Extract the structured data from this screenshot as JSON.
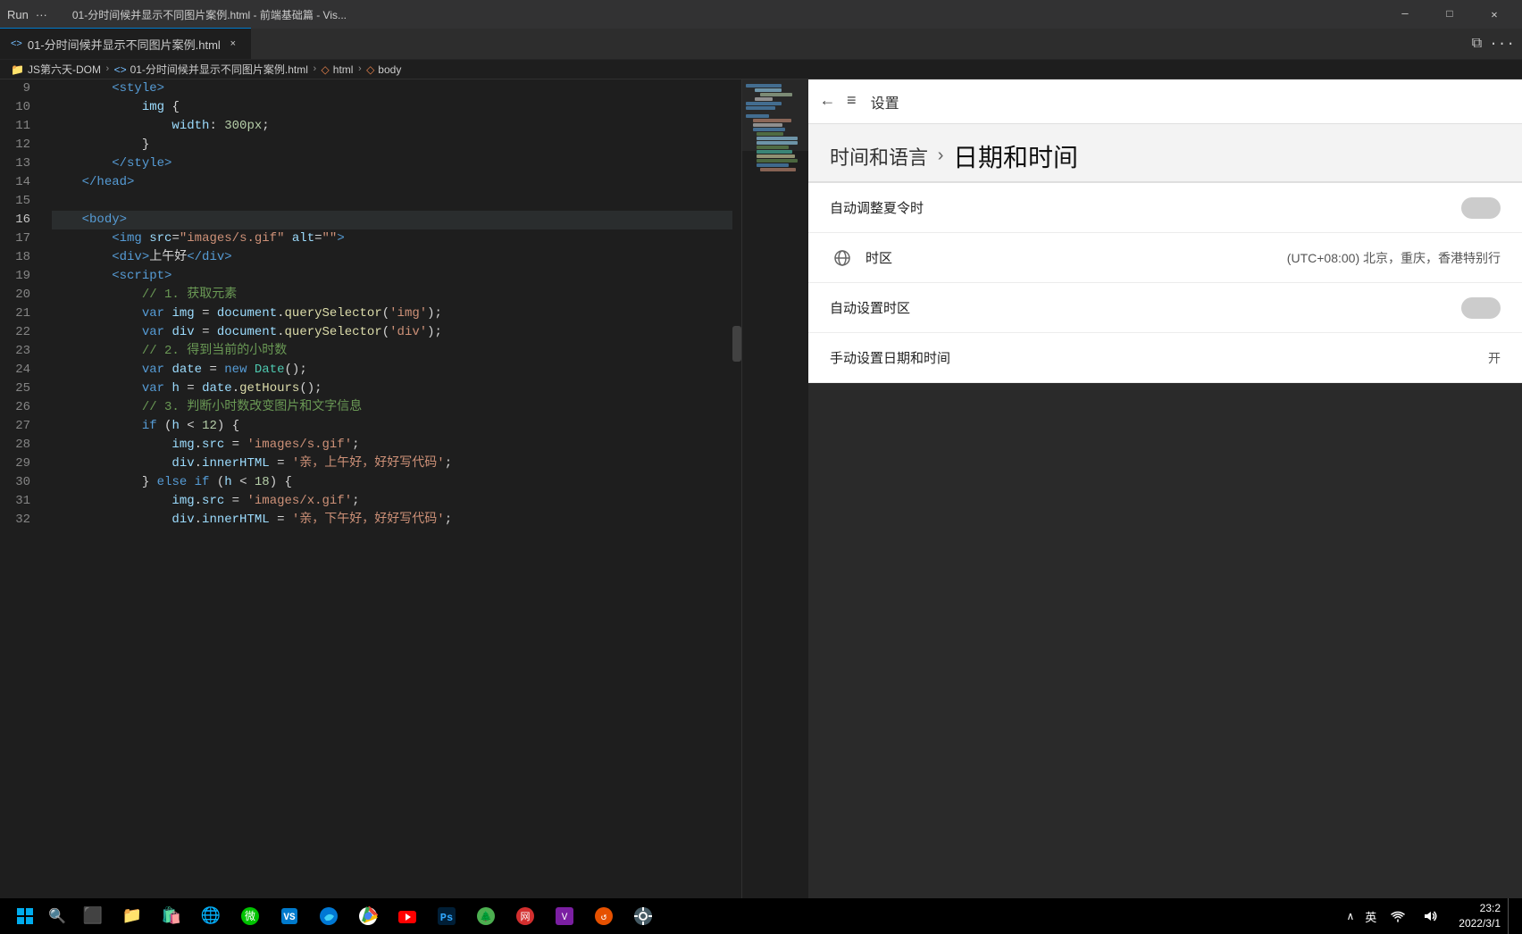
{
  "titlebar": {
    "menu_items": [
      "Run",
      "···"
    ],
    "title": "01-分时间候并显示不同图片案例.html - 前端基础篇 - Vis...",
    "controls": [
      "⬜",
      "❐",
      "✕"
    ]
  },
  "tab": {
    "icon": "<>",
    "label": "01-分时间候并显示不同图片案例.html",
    "close": "×"
  },
  "breadcrumb": {
    "items": [
      "JS第六天-DOM",
      "01-分时间候并显示不同图片案例.html",
      "html",
      "body"
    ]
  },
  "code": {
    "lines": [
      {
        "num": 9,
        "content": "        <style>"
      },
      {
        "num": 10,
        "content": "            img {"
      },
      {
        "num": 11,
        "content": "                width: 300px;"
      },
      {
        "num": 12,
        "content": "            }"
      },
      {
        "num": 13,
        "content": "        </style>"
      },
      {
        "num": 14,
        "content": "    </head>"
      },
      {
        "num": 15,
        "content": ""
      },
      {
        "num": 16,
        "content": "    <body>"
      },
      {
        "num": 17,
        "content": "        <img src=\"images/s.gif\" alt=\"\">"
      },
      {
        "num": 18,
        "content": "        <div>上午好</div>"
      },
      {
        "num": 19,
        "content": "        <script>"
      },
      {
        "num": 20,
        "content": "            // 1. 获取元素"
      },
      {
        "num": 21,
        "content": "            var img = document.querySelector('img');"
      },
      {
        "num": 22,
        "content": "            var div = document.querySelector('div');"
      },
      {
        "num": 23,
        "content": "            // 2. 得到当前的小时数"
      },
      {
        "num": 24,
        "content": "            var date = new Date();"
      },
      {
        "num": 25,
        "content": "            var h = date.getHours();"
      },
      {
        "num": 26,
        "content": "            // 3. 判断小时数改变图片和文字信息"
      },
      {
        "num": 27,
        "content": "            if (h < 12) {"
      },
      {
        "num": 28,
        "content": "                img.src = 'images/s.gif';"
      },
      {
        "num": 29,
        "content": "                div.innerHTML = '亲，上午好，好好写代码';"
      },
      {
        "num": 30,
        "content": "            } else if (h < 18) {"
      },
      {
        "num": 31,
        "content": "                img.src = 'images/x.gif';"
      },
      {
        "num": 32,
        "content": "                div.innerHTML = '亲，下午好，好好写代码';"
      }
    ]
  },
  "settings": {
    "back_label": "←",
    "menu_label": "≡",
    "header_title": "设置",
    "breadcrumb_parent": "时间和语言",
    "breadcrumb_arrow": "›",
    "breadcrumb_current": "日期和时间",
    "items": [
      {
        "label": "自动调整夏令时",
        "type": "toggle",
        "value": ""
      },
      {
        "label": "时区",
        "type": "value",
        "value": "(UTC+08:00) 北京，重庆，香港特别行",
        "has_icon": true
      },
      {
        "label": "自动设置时区",
        "type": "toggle",
        "value": ""
      },
      {
        "label": "手动设置日期和时间",
        "type": "button",
        "value": "开"
      }
    ]
  },
  "taskbar": {
    "clock_time": "23:2",
    "clock_date": "2022/3/1",
    "lang": "英",
    "apps": [
      "⊞",
      "🔍",
      "⬛",
      "📁",
      "🛒",
      "🌐",
      "💬",
      "💻",
      "🌐",
      "🎥",
      "🅿",
      "🌲",
      "🎵",
      "💜",
      "🔄",
      "⚙"
    ]
  }
}
